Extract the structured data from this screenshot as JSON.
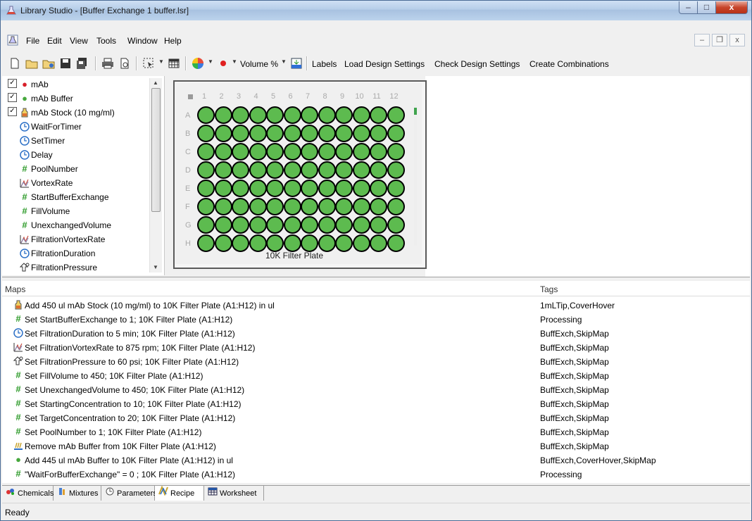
{
  "window": {
    "title": "Library Studio - [Buffer Exchange 1 buffer.lsr]",
    "caption_min": "–",
    "caption_max": "□",
    "caption_close": "x"
  },
  "menu": {
    "items": [
      "File",
      "Edit",
      "View",
      "Tools",
      "Window",
      "Help"
    ],
    "mdi_min": "–",
    "mdi_restore": "❐",
    "mdi_close": "x"
  },
  "toolbar": {
    "volume_label": "Volume %",
    "links": [
      "Labels",
      "Load Design Settings",
      "Check Design Settings",
      "Create Combinations"
    ]
  },
  "chemicals_list": [
    {
      "label": "mAb",
      "checked": true,
      "icon": "red-dot-icon"
    },
    {
      "label": "mAb Buffer",
      "checked": true,
      "icon": "green-dot-icon"
    },
    {
      "label": "mAb Stock (10 mg/ml)",
      "checked": true,
      "icon": "stock-bottle-icon"
    },
    {
      "label": "WaitForTimer",
      "checked": false,
      "icon": "clock-icon"
    },
    {
      "label": "SetTimer",
      "checked": false,
      "icon": "clock-icon"
    },
    {
      "label": "Delay",
      "checked": false,
      "icon": "clock-icon"
    },
    {
      "label": "PoolNumber",
      "checked": false,
      "icon": "hash-icon"
    },
    {
      "label": "VortexRate",
      "checked": false,
      "icon": "vortex-icon"
    },
    {
      "label": "StartBufferExchange",
      "checked": false,
      "icon": "hash-icon"
    },
    {
      "label": "FillVolume",
      "checked": false,
      "icon": "hash-icon"
    },
    {
      "label": "UnexchangedVolume",
      "checked": false,
      "icon": "hash-icon"
    },
    {
      "label": "FiltrationVortexRate",
      "checked": false,
      "icon": "vortex-icon"
    },
    {
      "label": "FiltrationDuration",
      "checked": false,
      "icon": "clock-icon"
    },
    {
      "label": "FiltrationPressure",
      "checked": false,
      "icon": "pressure-icon"
    }
  ],
  "plate": {
    "name": "10K Filter Plate",
    "columns": [
      "1",
      "2",
      "3",
      "4",
      "5",
      "6",
      "7",
      "8",
      "9",
      "10",
      "11",
      "12"
    ],
    "rows": [
      "A",
      "B",
      "C",
      "D",
      "E",
      "F",
      "G",
      "H"
    ],
    "well_color": "#5dbb4f"
  },
  "maps": {
    "header_maps": "Maps",
    "header_tags": "Tags",
    "rows": [
      {
        "icon": "stock-bottle-icon",
        "text": "Add 450 ul mAb Stock (10 mg/ml) to 10K Filter Plate (A1:H12) in ul",
        "tags": "1mLTip,CoverHover"
      },
      {
        "icon": "hash-icon",
        "text": "Set StartBufferExchange to 1; 10K Filter Plate (A1:H12)",
        "tags": "Processing"
      },
      {
        "icon": "clock-icon",
        "text": "Set FiltrationDuration to 5 min; 10K Filter Plate (A1:H12)",
        "tags": "BuffExch,SkipMap"
      },
      {
        "icon": "vortex-icon",
        "text": "Set FiltrationVortexRate to 875 rpm; 10K Filter Plate (A1:H12)",
        "tags": "BuffExch,SkipMap"
      },
      {
        "icon": "pressure-icon",
        "text": "Set FiltrationPressure to 60 psi; 10K Filter Plate (A1:H12)",
        "tags": "BuffExch,SkipMap"
      },
      {
        "icon": "hash-icon",
        "text": "Set FillVolume to 450; 10K Filter Plate (A1:H12)",
        "tags": "BuffExch,SkipMap"
      },
      {
        "icon": "hash-icon",
        "text": "Set UnexchangedVolume to 450; 10K Filter Plate (A1:H12)",
        "tags": "BuffExch,SkipMap"
      },
      {
        "icon": "hash-icon",
        "text": "Set StartingConcentration to 10; 10K Filter Plate (A1:H12)",
        "tags": "BuffExch,SkipMap"
      },
      {
        "icon": "hash-icon",
        "text": "Set TargetConcentration to 20; 10K Filter Plate (A1:H12)",
        "tags": "BuffExch,SkipMap"
      },
      {
        "icon": "hash-icon",
        "text": "Set PoolNumber to 1; 10K Filter Plate (A1:H12)",
        "tags": "BuffExch,SkipMap"
      },
      {
        "icon": "remove-icon",
        "text": "Remove mAb Buffer from 10K Filter Plate (A1:H12)",
        "tags": "BuffExch,SkipMap"
      },
      {
        "icon": "green-dot-icon",
        "text": "Add 445 ul mAb Buffer to 10K Filter Plate (A1:H12) in ul",
        "tags": "BuffExch,CoverHover,SkipMap"
      },
      {
        "icon": "hash-icon",
        "text": "\"WaitForBufferExchange\" = 0 ; 10K Filter Plate (A1:H12)",
        "tags": "Processing"
      }
    ]
  },
  "tabs": [
    {
      "label": "Chemicals",
      "icon": "chemicals-icon",
      "active": false
    },
    {
      "label": "Mixtures",
      "icon": "mixtures-icon",
      "active": false
    },
    {
      "label": "Parameters",
      "icon": "parameters-icon",
      "active": false
    },
    {
      "label": "Recipe",
      "icon": "recipe-icon",
      "active": true
    },
    {
      "label": "Worksheet",
      "icon": "worksheet-icon",
      "active": false
    }
  ],
  "status": {
    "text": "Ready"
  }
}
